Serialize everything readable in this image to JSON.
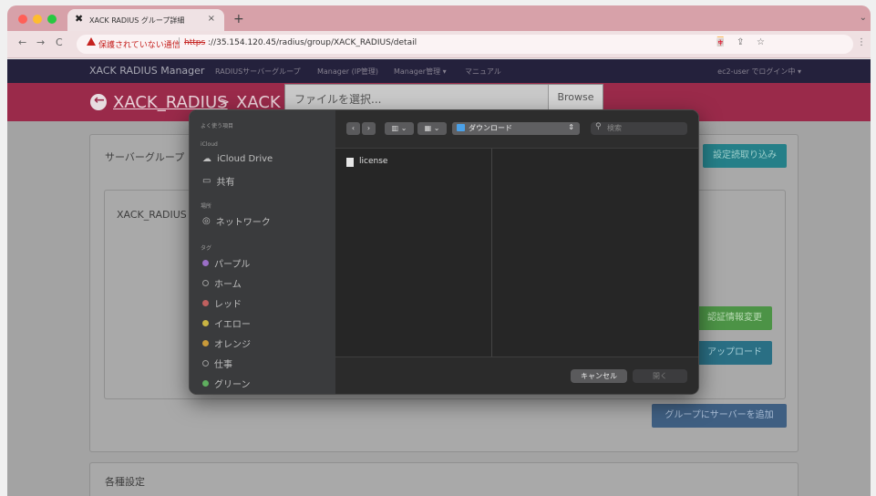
{
  "browser": {
    "tab_title": "XACK RADIUS グループ詳細",
    "tab_close": "×",
    "new_tab": "+",
    "tab_menu": "⌄",
    "nav": {
      "back": "←",
      "forward": "→",
      "reload": "C"
    },
    "security_warning": "保護されていない通信",
    "url_scheme": "https",
    "url_rest": "://35.154.120.45/radius/group/XACK_RADIUS/detail"
  },
  "app": {
    "brand": "XACK RADIUS Manager",
    "nav_items": [
      "RADIUSサーバーグループ",
      "Manager (IP管理)",
      "Manager管理 ▾",
      "マニュアル"
    ],
    "user_menu": "ec2-user でログイン中 ▾",
    "breadcrumb_root": "XACK_RADIUS",
    "breadcrumb_sep": ">",
    "breadcrumb_current": "XACK",
    "server_group_title": "サーバーグループ",
    "group_name": "XACK_RADIUS",
    "import_button": "設定読取り込み",
    "auth_change_button": "認証情報変更",
    "upload_button": "アップロード",
    "add_server_button": "グループにサーバーを追加",
    "settings_title": "各種設定",
    "file_input_placeholder": "ファイルを選択...",
    "browse_button": "Browse"
  },
  "dialog": {
    "favorites_header": "よく使う項目",
    "icloud_header": "iCloud",
    "icloud_drive": "iCloud Drive",
    "shared": "共有",
    "locations_header": "場所",
    "network": "ネットワーク",
    "tags_header": "タグ",
    "tags": [
      {
        "label": "パープル",
        "color": "#9b6fc7"
      },
      {
        "label": "ホーム",
        "color": ""
      },
      {
        "label": "レッド",
        "color": "#c0605f"
      },
      {
        "label": "イエロー",
        "color": "#c9b443"
      },
      {
        "label": "オレンジ",
        "color": "#c99a3a"
      },
      {
        "label": "仕事",
        "color": ""
      },
      {
        "label": "グリーン",
        "color": "#5fae5f"
      }
    ],
    "location": "ダウンロード",
    "search_placeholder": "検索",
    "files": [
      "license"
    ],
    "cancel": "キャンセル",
    "open": "開く"
  }
}
